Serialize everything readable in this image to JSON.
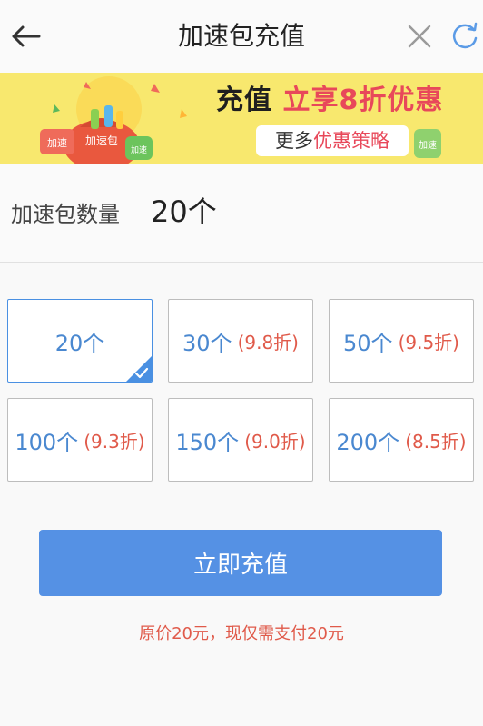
{
  "header": {
    "title": "加速包充值",
    "back_icon": "arrow-left-icon",
    "close_icon": "close-icon",
    "refresh_icon": "refresh-icon"
  },
  "banner": {
    "headline_black": "充值",
    "headline_red": "立享8折优惠",
    "pill_gray": "更多",
    "pill_red": "优惠策略",
    "bag_label": "加速包",
    "badge_left": "加速",
    "badge_right": "加速",
    "badge_corner": "加速"
  },
  "quantity": {
    "label": "加速包数量",
    "value": "20个"
  },
  "options": [
    {
      "count": "20个",
      "discount": "",
      "selected": true
    },
    {
      "count": "30个",
      "discount": "(9.8折)",
      "selected": false
    },
    {
      "count": "50个",
      "discount": "(9.5折)",
      "selected": false
    },
    {
      "count": "100个",
      "discount": "(9.3折)",
      "selected": false
    },
    {
      "count": "150个",
      "discount": "(9.0折)",
      "selected": false
    },
    {
      "count": "200个",
      "discount": "(8.5折)",
      "selected": false
    }
  ],
  "submit_label": "立即充值",
  "price_note": "原价20元，现仅需支付20元",
  "colors": {
    "accent": "#5591e4",
    "discount": "#e05a4a",
    "banner_bg": "#f8e86e"
  }
}
